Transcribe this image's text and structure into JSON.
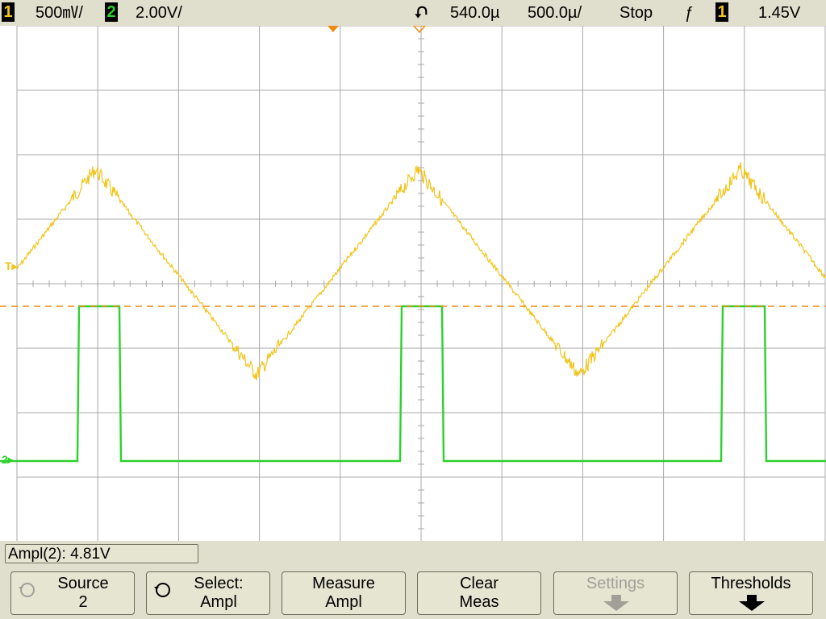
{
  "status_bar": {
    "ch1_number": "1",
    "ch1_scale": "500㎷/",
    "ch2_number": "2",
    "ch2_scale": "2.00V/",
    "time_delay": "540.0µ",
    "time_scale": "500.0µ/",
    "run_state": "Stop",
    "trigger_slope_symbol": "ƒ",
    "trigger_source": "1",
    "trigger_level": "1.45V"
  },
  "colors": {
    "ch1": "#f2c418",
    "ch2": "#2cd12c",
    "trigger": "#f08a14",
    "grid": "#a8a8a8"
  },
  "markers": {
    "trigger_level_marker": "T",
    "ch2_ground_marker": "2"
  },
  "measurement": {
    "readout": "Ampl(2): 4.81V"
  },
  "softkeys": [
    {
      "line1": "Source",
      "line2": "2",
      "icon": "rotate-knob-icon",
      "enabled": true
    },
    {
      "line1": "Select:",
      "line2": "Ampl",
      "icon": "rotate-knob-icon",
      "enabled": true
    },
    {
      "line1": "Measure",
      "line2": "Ampl",
      "enabled": true
    },
    {
      "line1": "Clear",
      "line2": "Meas",
      "enabled": true
    },
    {
      "line1": "Settings",
      "line2": "",
      "icon": "down-arrow-icon",
      "enabled": false
    },
    {
      "line1": "Thresholds",
      "line2": "",
      "icon": "down-arrow-icon",
      "enabled": true
    }
  ]
}
